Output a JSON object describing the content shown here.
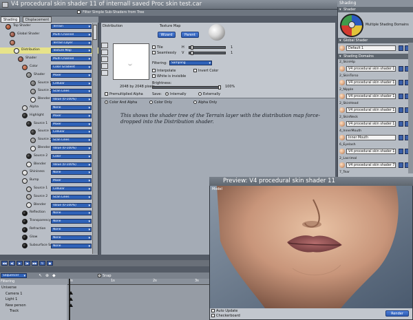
{
  "window": {
    "title": "V4 procedural skin shader 11 of internall saved Proc skin test.car"
  },
  "filter": {
    "label": "Filter Simple Sub-Shaders from Tree"
  },
  "tabs": [
    {
      "label": "Shading"
    },
    {
      "label": "Displacement"
    }
  ],
  "tree": [
    {
      "label": "Top Shader",
      "value": "Terrain",
      "color": "#b55a3a"
    },
    {
      "label": "Global Shader",
      "value": "Multi Channel",
      "color": "#a05a48"
    },
    {
      "label": "",
      "value": "Terrain Layer",
      "color": "#b06a50"
    },
    {
      "label": "Distribution",
      "value": "Texture Map",
      "color": "#e8e8e8"
    },
    {
      "label": "Shader",
      "value": "Multi Channel",
      "color": "#a05a48"
    },
    {
      "label": "Color",
      "value": "Color Gradient",
      "color": "#c06848"
    },
    {
      "label": "Shader",
      "value": "Mixer",
      "color": "#888888"
    },
    {
      "label": "Source 1",
      "value": "Cellular",
      "color": "#777777"
    },
    {
      "label": "Source 2",
      "value": "Scan Lines",
      "color": "#999999"
    },
    {
      "label": "Blender",
      "value": "Value (0-100%)",
      "color": "#e0e0e0"
    },
    {
      "label": "Alpha",
      "value": "None",
      "color": "#cccccc"
    },
    {
      "label": "Highlight",
      "value": "Mixer",
      "color": "#222222"
    },
    {
      "label": "Source 1",
      "value": "Mixer",
      "color": "#222222"
    },
    {
      "label": "Source 1",
      "value": "Cellular",
      "color": "#333333"
    },
    {
      "label": "Source 2",
      "value": "Scan Lines",
      "color": "#999999"
    },
    {
      "label": "Blender",
      "value": "Value (0-100%)",
      "color": "#e0e0e0"
    },
    {
      "label": "Source 2",
      "value": "Color",
      "color": "#222222"
    },
    {
      "label": "Blender",
      "value": "Value (0-100%)",
      "color": "#e0e0e0"
    },
    {
      "label": "Shininess",
      "value": "None",
      "color": "#dddddd"
    },
    {
      "label": "Bump",
      "value": "Mixer",
      "color": "#cccccc"
    },
    {
      "label": "Source 1",
      "value": "Cellular",
      "color": "#bbbbbb"
    },
    {
      "label": "Source 2",
      "value": "Scan Lines",
      "color": "#aaaaaa"
    },
    {
      "label": "Blender",
      "value": "Value (0-100%)",
      "color": "#e0e0e0"
    },
    {
      "label": "Reflection",
      "value": "None",
      "color": "#111111"
    },
    {
      "label": "Transparency",
      "value": "None",
      "color": "#111111"
    },
    {
      "label": "Refraction",
      "value": "None",
      "color": "#111111"
    },
    {
      "label": "Glow",
      "value": "None",
      "color": "#111111"
    },
    {
      "label": "Subsurface Sc",
      "value": "None",
      "color": "#111111"
    }
  ],
  "editor": {
    "breadcrumb": "Distribution",
    "type_label": "Texture Map",
    "wizard": "Wizard",
    "parent": "Parent",
    "tile": "Tile",
    "seamlessly": "Seamlessly",
    "h": "H",
    "v": "V",
    "h_val": "1",
    "v_val": "1",
    "filtering_label": "Filtering:",
    "filtering_value": "Sampling",
    "interpolate": "Interpolate",
    "invert_color": "Invert Color",
    "white_invisible": "White is invisible",
    "size": "2048 by 2048 pixels",
    "brightness_label": "Brightness:",
    "brightness_value": "100%",
    "brightness_fraction": 1.0,
    "premultiplied": "Premultiplied Alpha",
    "save_label": "Save:",
    "internally": "Internally",
    "externally": "Externally",
    "color_alpha": "Color And Alpha",
    "color_only": "Color Only",
    "alpha_only": "Alpha Only"
  },
  "note": "This shows the shader tree of the Terrain layer with the distribution map force-dropped into the Distribution shader.",
  "right": {
    "title": "Shading",
    "shader_head": "Shader",
    "shader_name": "Multiple Shading Domains",
    "global_head": "Global Shader",
    "global_default": "Default 1",
    "domains_head": "Shading Domains",
    "domains": [
      {
        "name": "2_SkinHip",
        "shader": "V4 procedural skin shader 1"
      },
      {
        "name": "2_SkinTorso",
        "shader": "V4 procedural skin shader 1"
      },
      {
        "name": "2_Nipple",
        "shader": "V4 procedural skin shader 1"
      },
      {
        "name": "2_SkinHead",
        "shader": "V4 procedural skin shader 1"
      },
      {
        "name": "2_SkinNeck",
        "shader": "V4 procedural skin shader 1"
      },
      {
        "name": "4_InnerMouth",
        "shader": "Inner Mouth"
      },
      {
        "name": "6_Eyelash",
        "shader": "V4 procedural skin shader 1"
      },
      {
        "name": "2_Lacrimal",
        "shader": "V4 procedural skin shader 7"
      },
      {
        "name": "7_Tear",
        "shader": ""
      }
    ]
  },
  "timeline": {
    "sequencer": "Sequencer",
    "snap": "Snap",
    "filtering": "Filtering",
    "ticks": [
      "0s",
      "1s",
      "2s",
      "3s"
    ],
    "items": [
      "Universe",
      "Camera 1",
      "Light 1",
      "New person",
      "Track"
    ]
  },
  "preview": {
    "title": "Preview: V4 procedural skin shader 11",
    "model": "Model",
    "auto_update": "Auto Update",
    "checkerboard": "Checkerboard",
    "render": "Render"
  }
}
